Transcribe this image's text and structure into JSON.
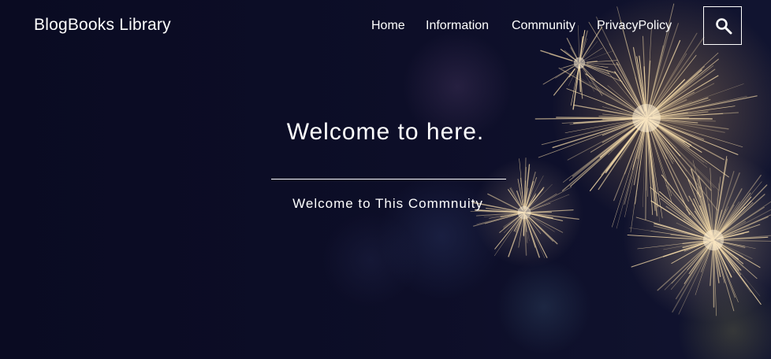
{
  "header": {
    "brand": "BlogBooks Library",
    "nav": [
      "Home",
      "Information",
      "Community",
      "PrivacyPolicy"
    ],
    "search_icon": "search-icon"
  },
  "hero": {
    "title": "Welcome to here.",
    "subtitle": "Welcome to This Commnuity"
  },
  "colors": {
    "background": "#0d0d25",
    "text": "#ffffff",
    "spark": "#f3d9a8"
  }
}
